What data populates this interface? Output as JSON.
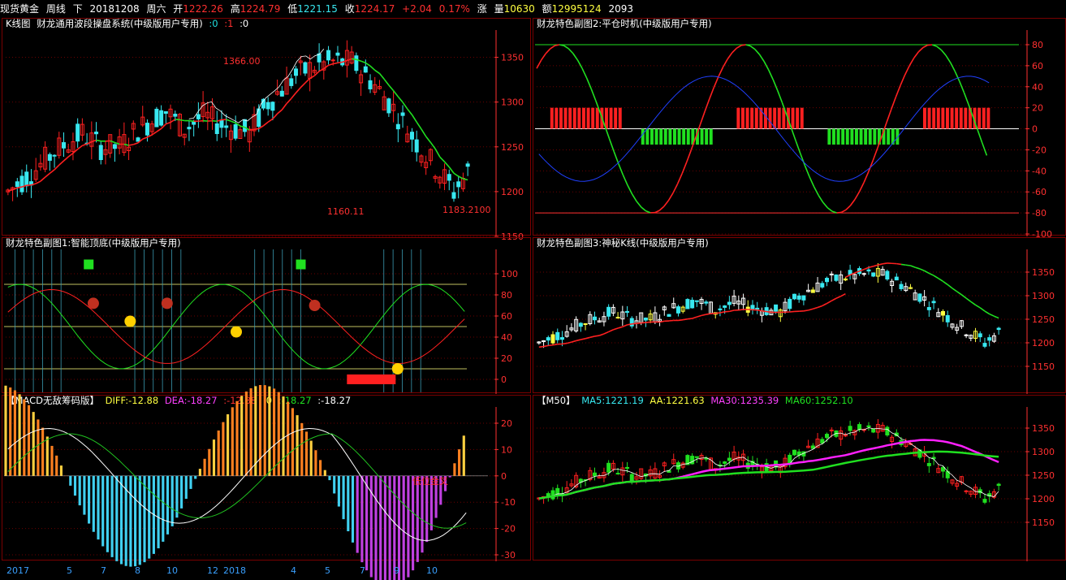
{
  "header": {
    "instrument": "现货黄金",
    "period": "周线",
    "down_label": "下",
    "date": "20181208",
    "weekday": "周六",
    "open_label": "开",
    "open": "1222.26",
    "high_label": "高",
    "high": "1224.79",
    "low_label": "低",
    "low": "1221.15",
    "close_label": "收",
    "close": "1224.17",
    "change_label": "涨",
    "change": "+2.04",
    "change_pct": "0.17%",
    "volume_label": "量",
    "volume": "10630",
    "amount_label": "额",
    "amount": "12995124",
    "extra": "2093"
  },
  "colors": {
    "up": "#ff2020",
    "down": "#38e8f0",
    "axis": "#ff3030",
    "frame": "#7a0000",
    "green": "#20e020",
    "magenta": "#ff20ff",
    "yellow": "#ffff20",
    "white": "#ffffff",
    "blue": "#2040ff"
  },
  "panels": {
    "kline": {
      "title": "K线图",
      "sys_title": "财龙通用波段操盘系统(中级版用户专用)",
      "v1": ":0",
      "v2": ":1",
      "v3": ":0",
      "high_mark": "1366.00",
      "low_mark": "1160.11",
      "cur_mark": "1183.2100",
      "yticks": [
        "1350",
        "1300",
        "1250",
        "1200",
        "1150"
      ]
    },
    "sub2": {
      "title": "财龙特色副图2:平仓时机(中级版用户专用)",
      "yticks": [
        "80",
        "60",
        "40",
        "20",
        "0",
        "-20",
        "-40",
        "-60",
        "-80",
        "-100"
      ]
    },
    "sub1": {
      "title": "财龙特色副图1:智能顶底(中级版用户专用)",
      "yticks": [
        "100",
        "80",
        "60",
        "40",
        "20",
        "0"
      ]
    },
    "sub3": {
      "title": "财龙特色副图3:神秘K线(中级版用户专用)",
      "yticks": [
        "1350",
        "1300",
        "1250",
        "1200",
        "1150"
      ]
    },
    "macd": {
      "title": "【MACD无敌筹码版】",
      "diff": "DIFF:-12.88",
      "dea": "DEA:-18.27",
      "v1": ":-12.88",
      "v2": ":0",
      "v3": ":-18.27",
      "v4": ":-18.27",
      "annotation": "低位金叉",
      "yticks": [
        "20",
        "10",
        "0",
        "-10",
        "-20",
        "-30"
      ]
    },
    "m50": {
      "title": "【M50】",
      "ma5": "MA5:1221.19",
      "aa": "AA:1221.63",
      "ma30": "MA30:1235.39",
      "ma60": "MA60:1252.10",
      "yticks": [
        "1350",
        "1300",
        "1250",
        "1200",
        "1150"
      ]
    }
  },
  "xaxis": [
    "2017",
    "5",
    "7",
    "8",
    "10",
    "12",
    "2018",
    "4",
    "5",
    "7",
    "9",
    "10"
  ]
}
